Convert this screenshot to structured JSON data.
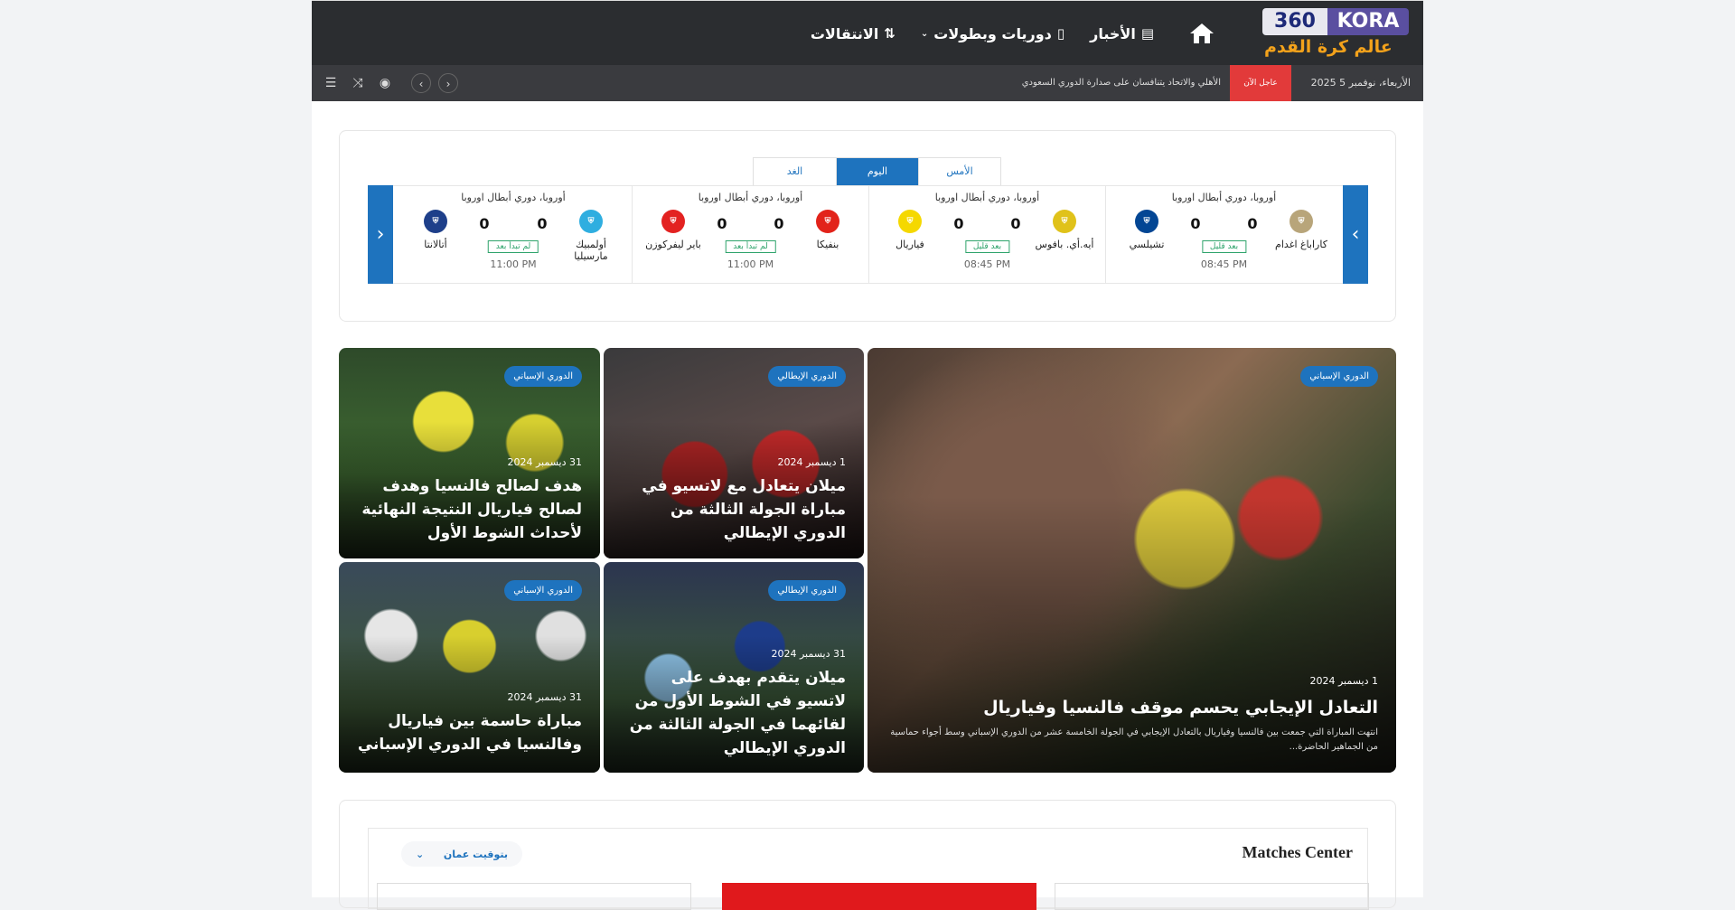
{
  "header": {
    "logo_number": "360",
    "logo_word": "KORA",
    "logo_tagline": "عالم كرة القدم",
    "nav": [
      {
        "label": "الأخبار",
        "icon": "newspaper-icon"
      },
      {
        "label": "دوريات وبطولات",
        "icon": "book-icon"
      },
      {
        "label": "الانتقالات",
        "icon": "transfer-icon"
      }
    ],
    "date": "الأربعاء، نوفمبر 5 2025",
    "breaking_label": "عاجل الآن",
    "breaking_text": "الأهلي والاتحاد يتنافسان على صدارة الدوري السعودي"
  },
  "matches": {
    "tabs": [
      "الأمس",
      "اليوم",
      "الغد"
    ],
    "active_tab": "اليوم",
    "items": [
      {
        "league": "أوروبا، دوري أبطال اوروبا",
        "home": "كاراباغ اغدام",
        "away": "تشيلسي",
        "home_score": "0",
        "away_score": "0",
        "status": "بعد قليل",
        "time": "08:45 PM",
        "home_color": "#b8a57a",
        "away_color": "#034694"
      },
      {
        "league": "أوروبا، دوري أبطال اوروبا",
        "home": "أيه.أي. بافوس",
        "away": "فياريال",
        "home_score": "0",
        "away_score": "0",
        "status": "بعد قليل",
        "time": "08:45 PM",
        "home_color": "#e0c21a",
        "away_color": "#f5d800"
      },
      {
        "league": "أوروبا، دوري أبطال اوروبا",
        "home": "بنفيكا",
        "away": "باير ليفركوزن",
        "home_score": "0",
        "away_score": "0",
        "status": "لم تبدأ بعد",
        "time": "11:00 PM",
        "home_color": "#e2231a",
        "away_color": "#e32221"
      },
      {
        "league": "أوروبا، دوري أبطال اوروبا",
        "home": "أولمبيك مارسيليا",
        "away": "أتالانتا",
        "home_score": "0",
        "away_score": "0",
        "status": "لم تبدأ بعد",
        "time": "11:00 PM",
        "home_color": "#2faee0",
        "away_color": "#1e3f8a"
      }
    ]
  },
  "news": {
    "main": {
      "badge": "الدوري الإسباني",
      "date": "1 ديسمبر 2024",
      "title": "التعادل الإيجابي يحسم موقف فالنسيا وفياريال",
      "excerpt": "انتهت المباراة التي جمعت بين فالنسيا وفياريال بالتعادل الإيجابي في الجولة الخامسة عشر من الدوري الإسباني وسط أجواء حماسية من الجماهير الحاضرة..."
    },
    "r1": {
      "badge": "الدوري الإيطالي",
      "date": "1 ديسمبر 2024",
      "title": "ميلان يتعادل مع لاتسيو في مباراة الجولة الثالثة من الدوري الإيطالي"
    },
    "l1": {
      "badge": "الدوري الإسباني",
      "date": "31 ديسمبر 2024",
      "title": "هدف لصالح فالنسيا وهدف لصالح فياريال النتيجة النهائية لأحداث الشوط الأول"
    },
    "r2": {
      "badge": "الدوري الإيطالي",
      "date": "31 ديسمبر 2024",
      "title": "ميلان يتقدم بهدف على لاتسيو في الشوط الأول من لقائهما في الجولة الثالثة من الدوري الإيطالي"
    },
    "l2": {
      "badge": "الدوري الإسباني",
      "date": "31 ديسمبر 2024",
      "title": "مباراة حاسمة بين فياريال وفالنسيا في الدوري الإسباني"
    }
  },
  "matches_center": {
    "title": "Matches Center",
    "timezone": "بتوقيت عمان"
  }
}
